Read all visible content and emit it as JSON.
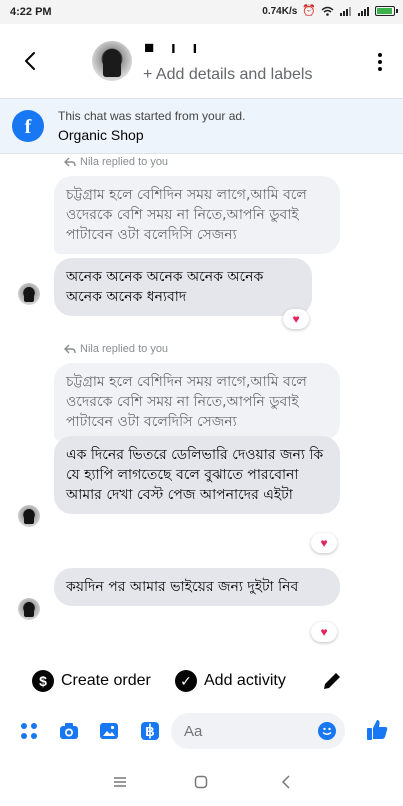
{
  "status_bar": {
    "time": "4:22 PM",
    "speed": "0.74K/s",
    "icons": [
      "alarm-icon",
      "wifi-icon",
      "signal-icon",
      "signal-icon",
      "battery-icon"
    ],
    "battery_color": "#3bb34a"
  },
  "header": {
    "contact_name": "■ ı ı",
    "subtitle": "+ Add details and labels"
  },
  "ad_banner": {
    "note": "This chat was started from your ad.",
    "shop_name": "Organic Shop",
    "accent": "#1877f2"
  },
  "messages": [
    {
      "reply_label": "Nila replied to you",
      "quoted": "চট্টগ্রাম হলে বেশিদিন সময় লাগে,আমি বলে ওদেরকে বেশি সময় না নিতে,আপনি ডুবাই পাটাবেন ওটা বলেদিসি সেজন্য",
      "text": "অনেক অনেক অনেক অনেক অনেক অনেক অনেক ধন্যবাদ",
      "reaction": "♥"
    },
    {
      "reply_label": "Nila replied to you",
      "quoted": "চট্টগ্রাম হলে বেশিদিন সময় লাগে,আমি বলে ওদেরকে বেশি সময় না নিতে,আপনি ডুবাই পাটাবেন ওটা বলেদিসি সেজন্য",
      "text": "এক দিনের ভিতরে ডেলিভারি দেওয়ার জন্য কি যে হ্যাপি লাগতেছে বলে বুঝাতে পারবোনা আমার দেখা বেস্ট পেজ আপনাদের এইটা",
      "reaction": "♥"
    },
    {
      "text": "কয়দিন পর আমার ভাইয়ের জন্য দুইটা নিব",
      "reaction": "♥"
    }
  ],
  "actions": {
    "create_order": "Create order",
    "add_activity": "Add activity",
    "create_order_glyph": "$",
    "add_activity_glyph": "✓"
  },
  "composer": {
    "placeholder": "Aa"
  },
  "colors": {
    "messenger_blue": "#1877f2",
    "bubble_gray": "#e4e6eb",
    "heart_red": "#e0245e"
  }
}
